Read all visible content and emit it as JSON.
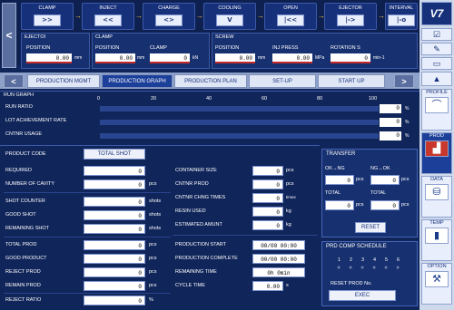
{
  "top": {
    "stages": [
      {
        "label": "CLAMP",
        "icon": ">>"
      },
      {
        "label": "INJECT",
        "icon": "<<"
      },
      {
        "label": "CHARGE",
        "icon": "<>"
      },
      {
        "label": "COOLING",
        "icon": "V"
      },
      {
        "label": "OPEN",
        "icon": "|<<"
      },
      {
        "label": "EJECTOR",
        "icon": "|->"
      },
      {
        "label": "INTERVAL",
        "icon": "|-o"
      }
    ]
  },
  "params": {
    "ejector": {
      "head": "EJECTOI",
      "position_label": "POSITION",
      "position_value": "0.00",
      "position_unit": "mm"
    },
    "clamp": {
      "head": "CLAMP",
      "position_label": "POSITION",
      "position_value": "0.00",
      "position_unit": "mm",
      "clamp_label": "CLAMP",
      "clamp_value": "0",
      "clamp_unit": "kN"
    },
    "screw": {
      "head": "SCREW",
      "position_label": "POSITION",
      "position_value": "0.00",
      "position_unit": "mm",
      "inj_label": "INJ PRESS",
      "inj_value": "0.00",
      "inj_unit": "MPa",
      "rot_label": "ROTATION S",
      "rot_value": "0",
      "rot_unit": "min-1"
    }
  },
  "tabs": [
    "PRODUCTION MGMT",
    "PRODUCTION GRAPH",
    "PRODUCTION PLAN",
    "SET-UP",
    "START UP"
  ],
  "run_graph": {
    "title": "RUN GRAPH",
    "scale": [
      "0",
      "20",
      "40",
      "60",
      "80",
      "100"
    ],
    "rows": [
      {
        "label": "RUN RATIO",
        "value": "0",
        "unit": "%"
      },
      {
        "label": "LOT ACHIEVEMENT RATE",
        "value": "0",
        "unit": "%"
      },
      {
        "label": "CNTNR USAGE",
        "value": "0",
        "unit": "%"
      }
    ]
  },
  "product": {
    "code_label": "PRODUCT CODE",
    "code_value": "TOTAL SHOT",
    "left": [
      {
        "label": "REQUIRED",
        "value": "0",
        "unit": ""
      },
      {
        "label": "NUMBER OF CAVITY",
        "value": "0",
        "unit": "pcs"
      },
      {
        "label": "SHOT COUNTER",
        "value": "0",
        "unit": "shots"
      },
      {
        "label": "GOOD SHOT",
        "value": "0",
        "unit": "shots"
      },
      {
        "label": "REMAINING SHOT",
        "value": "0",
        "unit": "shots"
      },
      {
        "label": "TOTAL PROD",
        "value": "0",
        "unit": "pcs"
      },
      {
        "label": "GOOD PRODUCT",
        "value": "0",
        "unit": "pcs"
      },
      {
        "label": "REJECT PROD",
        "value": "0",
        "unit": "pcs"
      },
      {
        "label": "REMAIN PROD",
        "value": "0",
        "unit": "pcs"
      },
      {
        "label": "REJECT RATIO",
        "value": "0",
        "unit": "%"
      }
    ],
    "mid": [
      {
        "label": "CONTAINER SIZE",
        "value": "0",
        "unit": "pcs"
      },
      {
        "label": "CNTNR PROD",
        "value": "0",
        "unit": "pcs"
      },
      {
        "label": "CNTNR CHNG TIMES",
        "value": "0",
        "unit": "times"
      },
      {
        "label": "RESIN USED",
        "value": "0",
        "unit": "kg"
      },
      {
        "label": "ESTIMATED AMUNT",
        "value": "0",
        "unit": "kg"
      },
      {
        "label": "PRODUCTION START",
        "value": "00/00 00:00",
        "unit": ""
      },
      {
        "label": "PRODUCTION COMPLETE",
        "value": "00/00 00:00",
        "unit": ""
      },
      {
        "label": "REMAINING TIME",
        "value": "0h 0min",
        "unit": ""
      },
      {
        "label": "CYCLE TIME",
        "value": "0.00",
        "unit": "s"
      }
    ]
  },
  "transfer": {
    "title": "TRANSFER",
    "ok_ng": "OK→NG",
    "ng_ok": "NG→OK",
    "ok_ng_value": "0",
    "ng_ok_value": "0",
    "total_label": "TOTAL",
    "total_left": "0",
    "total_right": "0",
    "unit": "pcs",
    "reset": "RESET"
  },
  "schedule": {
    "title": "PRD COMP SCHEDULE",
    "nums": [
      "1",
      "2",
      "3",
      "4",
      "5",
      "6"
    ],
    "reset_label": "RESET PROD No.",
    "exec": "EXEC"
  },
  "sidebar": {
    "logo": "V7",
    "items": [
      "PROFILE",
      "PROD",
      "DATA",
      "TEMP",
      "OPTION"
    ]
  }
}
